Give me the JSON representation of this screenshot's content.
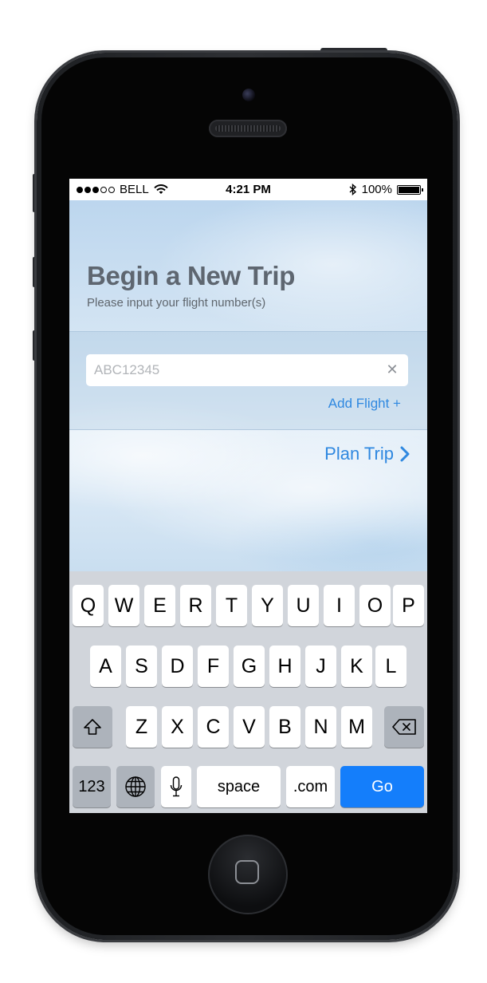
{
  "status_bar": {
    "carrier": "BELL",
    "time": "4:21 PM",
    "battery": "100%",
    "signal_bars_filled": 3,
    "signal_bars_total": 5
  },
  "page": {
    "title": "Begin a New Trip",
    "subtitle": "Please input your flight number(s)"
  },
  "flight_input": {
    "placeholder": "ABC12345",
    "value": ""
  },
  "actions": {
    "add_flight": "Add Flight +",
    "plan_trip": "Plan Trip"
  },
  "keyboard": {
    "row1": [
      "Q",
      "W",
      "E",
      "R",
      "T",
      "Y",
      "U",
      "I",
      "O",
      "P"
    ],
    "row2": [
      "A",
      "S",
      "D",
      "F",
      "G",
      "H",
      "J",
      "K",
      "L"
    ],
    "row3": [
      "Z",
      "X",
      "C",
      "V",
      "B",
      "N",
      "M"
    ],
    "numbers": "123",
    "space": "space",
    "dotcom": ".com",
    "go": "Go"
  },
  "colors": {
    "accent": "#2f88e0",
    "go_button": "#147efb",
    "title": "#5e6670"
  }
}
